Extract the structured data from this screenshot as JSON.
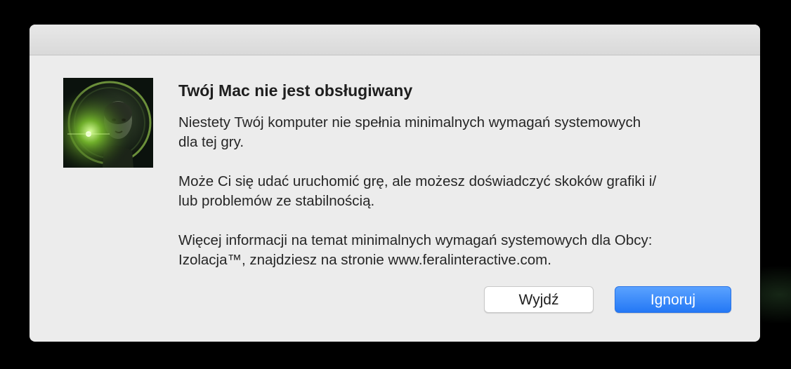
{
  "dialog": {
    "title": "Twój Mac nie jest obsługiwany",
    "paragraphs": [
      "Niestety Twój komputer nie spełnia minimalnych wymagań systemowych\ndla tej gry.",
      "Może Ci się udać uruchomić grę, ale możesz doświadczyć skoków grafiki i/\nlub problemów ze stabilnością.",
      "Więcej informacji na temat minimalnych wymagań systemowych dla Obcy:\nIzolacja™, znajdziesz na stronie www.feralinteractive.com."
    ],
    "buttons": {
      "quit_label": "Wyjdź",
      "ignore_label": "Ignoruj"
    }
  },
  "icons": {
    "app_icon": "alien-isolation-app-icon"
  },
  "colors": {
    "primary_button": "#2478f5",
    "dialog_background": "#ececec"
  }
}
